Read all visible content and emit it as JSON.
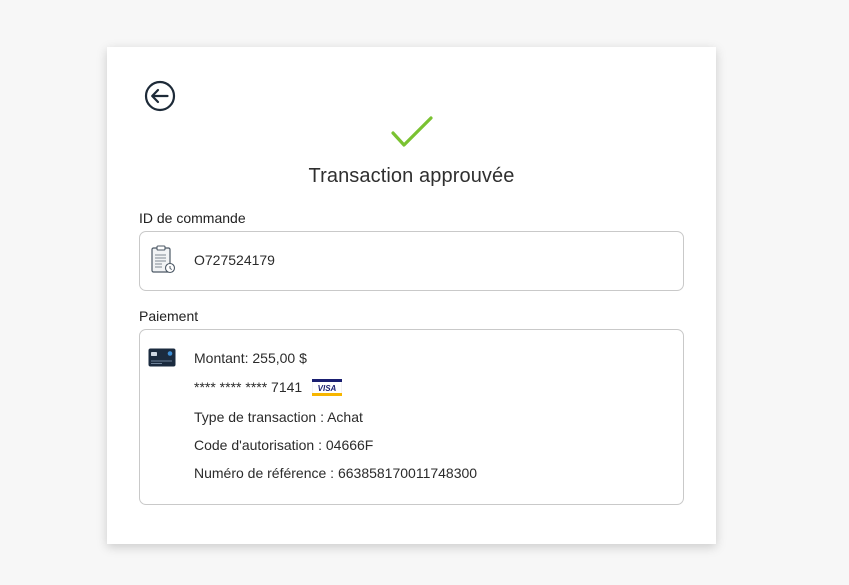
{
  "header": {
    "title": "Transaction approuvée"
  },
  "order": {
    "label": "ID de commande",
    "value": "O727524179"
  },
  "payment": {
    "label": "Paiement",
    "amount": "Montant: 255,00 $",
    "card_masked": "**** **** **** 7141",
    "card_brand": "VISA",
    "transaction_type": "Type de transaction : Achat",
    "auth_code": "Code d'autorisation : 04666F",
    "reference": "Numéro de référence : 663858170011748300"
  },
  "colors": {
    "check": "#7ac231",
    "back_icon": "#1d2a38",
    "card_icon": "#1b2b3f",
    "visa_blue": "#1a1f71",
    "visa_gold": "#f7b600"
  },
  "icons": {
    "back": "arrow-left-circle-icon",
    "status": "checkmark-icon",
    "order": "document-icon",
    "payment": "credit-card-icon",
    "brand": "visa-logo-icon"
  }
}
